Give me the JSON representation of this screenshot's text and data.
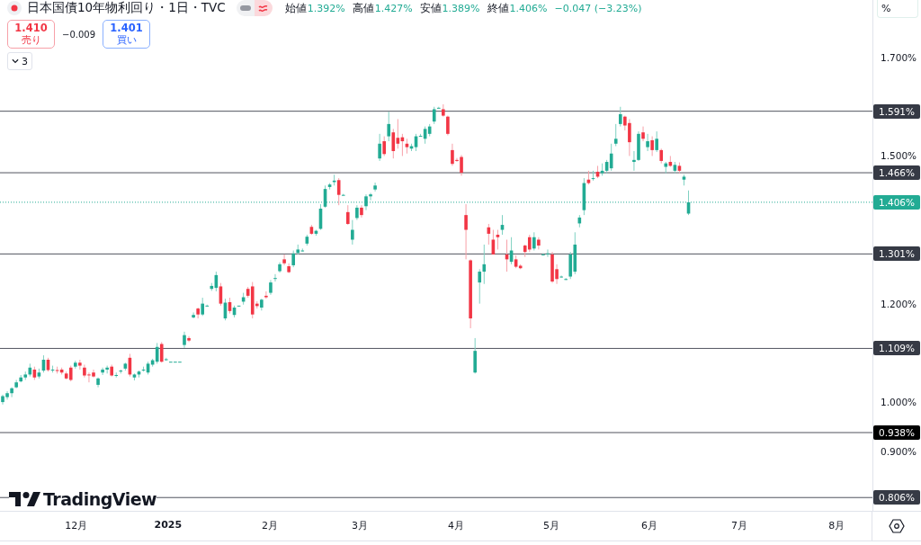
{
  "header": {
    "title": "日本国債10年物利回り・1日・TVC",
    "ohlc": [
      {
        "label": "始値",
        "value": "1.392%"
      },
      {
        "label": "高値",
        "value": "1.427%"
      },
      {
        "label": "安値",
        "value": "1.389%"
      },
      {
        "label": "終値",
        "value": "1.406%"
      }
    ],
    "change": "−0.047 (−3.23%)"
  },
  "trade": {
    "sell": {
      "price": "1.410",
      "label": "売り"
    },
    "spread": "−0.009",
    "buy": {
      "price": "1.401",
      "label": "買い"
    }
  },
  "display_modes": [
    {
      "selected": false
    },
    {
      "selected": true
    }
  ],
  "indicators_toggle": {
    "count": "3"
  },
  "logo": {
    "text": "TradingView"
  },
  "price_axis": {
    "unit": "%",
    "ticks": [
      "1.700%",
      "1.500%",
      "1.200%",
      "1.000%",
      "0.900%"
    ],
    "tags": [
      {
        "label": "1.591%",
        "kind": "level"
      },
      {
        "label": "1.466%",
        "kind": "level"
      },
      {
        "label": "1.406%",
        "kind": "last"
      },
      {
        "label": "1.301%",
        "kind": "level"
      },
      {
        "label": "1.109%",
        "kind": "level"
      },
      {
        "label": "0.938%",
        "kind": "marked"
      },
      {
        "label": "0.806%",
        "kind": "level"
      }
    ]
  },
  "time_axis": {
    "labels": [
      {
        "text": "12月",
        "bold": false
      },
      {
        "text": "2025",
        "bold": true
      },
      {
        "text": "2月",
        "bold": false
      },
      {
        "text": "3月",
        "bold": false
      },
      {
        "text": "4月",
        "bold": false
      },
      {
        "text": "5月",
        "bold": false
      },
      {
        "text": "6月",
        "bold": false
      },
      {
        "text": "7月",
        "bold": false
      },
      {
        "text": "8月",
        "bold": false
      }
    ]
  }
}
